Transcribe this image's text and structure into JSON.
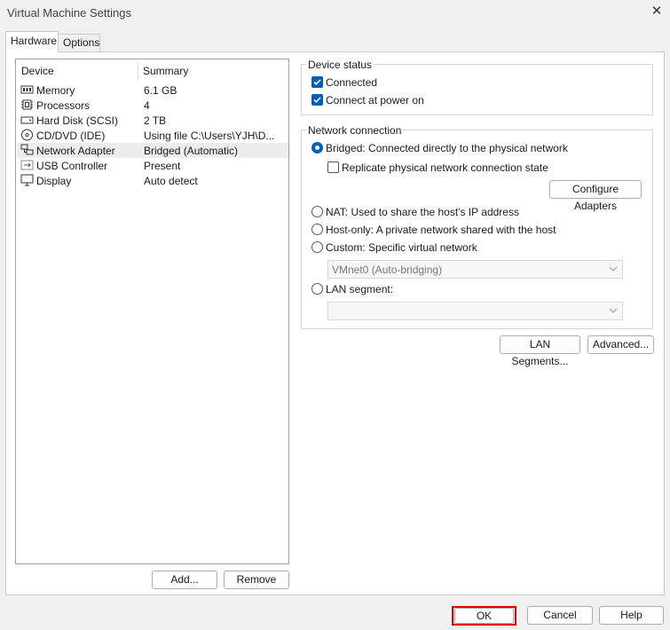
{
  "window": {
    "title": "Virtual Machine Settings"
  },
  "tabs": [
    {
      "label": "Hardware"
    },
    {
      "label": "Options"
    }
  ],
  "device_list": {
    "columns": {
      "device": "Device",
      "summary": "Summary"
    },
    "rows": [
      {
        "name": "Memory",
        "summary": "6.1 GB",
        "icon": "memory-icon"
      },
      {
        "name": "Processors",
        "summary": "4",
        "icon": "processor-icon"
      },
      {
        "name": "Hard Disk (SCSI)",
        "summary": "2 TB",
        "icon": "hard-disk-icon"
      },
      {
        "name": "CD/DVD (IDE)",
        "summary": "Using file C:\\Users\\YJH\\D...",
        "icon": "cd-dvd-icon"
      },
      {
        "name": "Network Adapter",
        "summary": "Bridged (Automatic)",
        "icon": "network-adapter-icon"
      },
      {
        "name": "USB Controller",
        "summary": "Present",
        "icon": "usb-icon"
      },
      {
        "name": "Display",
        "summary": "Auto detect",
        "icon": "display-icon"
      }
    ],
    "selected_row": "Network Adapter",
    "add_label": "Add...",
    "remove_label": "Remove"
  },
  "device_status": {
    "label": "Device status",
    "connected": {
      "label": "Connected",
      "checked": true
    },
    "connect_power_on": {
      "label": "Connect at power on",
      "checked": true
    }
  },
  "network_connection": {
    "label": "Network connection",
    "bridged": {
      "label": "Bridged: Connected directly to the physical network",
      "selected": true
    },
    "replicate": {
      "label": "Replicate physical network connection state",
      "checked": false
    },
    "configure_adapters_label": "Configure Adapters",
    "nat": {
      "label": "NAT: Used to share the host's IP address"
    },
    "host_only": {
      "label": "Host-only: A private network shared with the host"
    },
    "custom": {
      "label": "Custom: Specific virtual network"
    },
    "custom_network": {
      "value": "VMnet0 (Auto-bridging)"
    },
    "lan_segment": {
      "label": "LAN segment:"
    },
    "lan_segment_value": {
      "value": ""
    }
  },
  "side_buttons": {
    "lan_segments": "LAN Segments...",
    "advanced": "Advanced..."
  },
  "footer": {
    "ok": "OK",
    "cancel": "Cancel",
    "help": "Help"
  },
  "colors": {
    "accent": "#005fb8",
    "highlight": "#e00000",
    "selected_row": "#ececec"
  }
}
